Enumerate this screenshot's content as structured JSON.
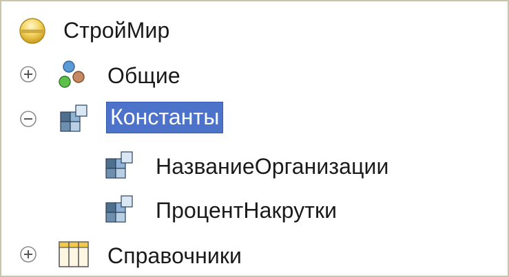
{
  "tree": {
    "root": {
      "label": "СтройМир",
      "icon": "config-root-icon"
    },
    "items": [
      {
        "label": "Общие",
        "icon": "common-objects-icon",
        "toggle": "expand",
        "level": 1
      },
      {
        "label": "Константы",
        "icon": "constants-icon",
        "toggle": "collapse",
        "level": 1,
        "selected": true
      },
      {
        "label": "НазваниеОрганизации",
        "icon": "constant-icon",
        "level": 2
      },
      {
        "label": "ПроцентНакрутки",
        "icon": "constant-icon",
        "level": 2
      },
      {
        "label": "Справочники",
        "icon": "catalogs-icon",
        "toggle": "expand",
        "level": 1
      }
    ]
  },
  "colors": {
    "selection_bg": "#4c72c9",
    "frame_border": "#c9c6a6",
    "root_icon": "#e8c94a"
  }
}
